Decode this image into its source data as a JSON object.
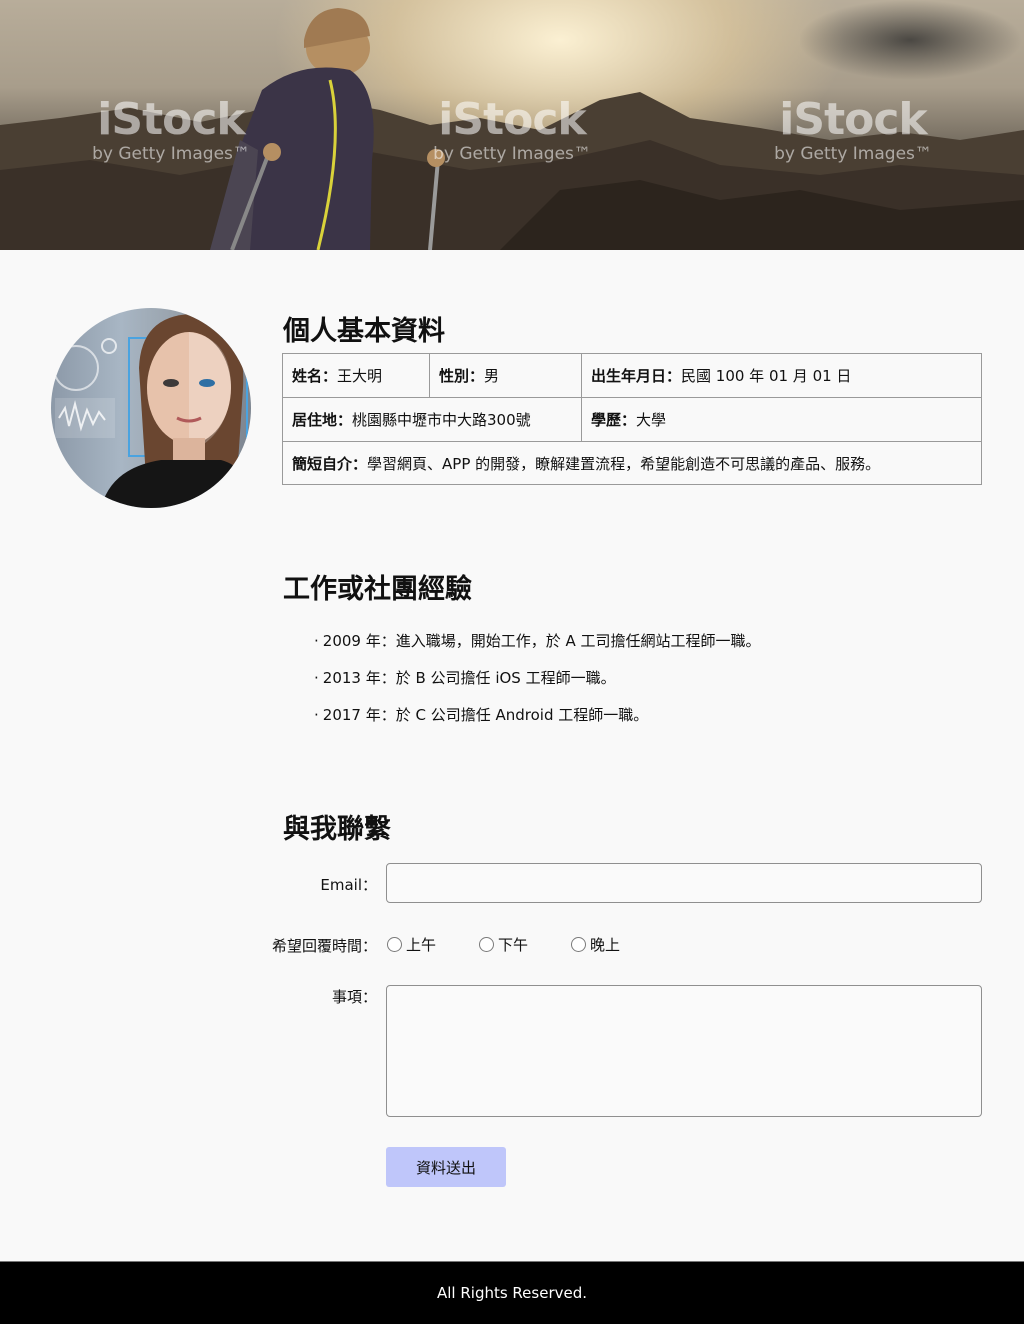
{
  "banner": {
    "watermarks": [
      {
        "main": "iStock",
        "sub": "by Getty Images™"
      },
      {
        "main": "iStock",
        "sub": "by Getty Images™"
      },
      {
        "main": "iStock",
        "sub": "by Getty Images™"
      }
    ]
  },
  "basic_info": {
    "title": "個人基本資料",
    "name": {
      "key": "姓名：",
      "value": "王大明"
    },
    "gender": {
      "key": "性別：",
      "value": "男"
    },
    "birthday": {
      "key": "出生年月日：",
      "value": "民國 100 年 01 月 01 日"
    },
    "address": {
      "key": "居住地：",
      "value": "桃園縣中壢市中大路300號"
    },
    "education": {
      "key": "學歷：",
      "value": "大學"
    },
    "intro": {
      "key": "簡短自介：",
      "value": "學習網頁、APP 的開發，瞭解建置流程，希望能創造不可思議的產品、服務。"
    }
  },
  "experience": {
    "title": "工作或社團經驗",
    "items": [
      "2009 年：進入職場，開始工作，於 A 工司擔任網站工程師一職。",
      "2013 年：於 B 公司擔任 iOS 工程師一職。",
      "2017 年：於 C 公司擔任 Android 工程師一職。"
    ]
  },
  "contact": {
    "title": "與我聯繫",
    "email_label": "Email：",
    "email_value": "",
    "time_label": "希望回覆時間：",
    "time_options": [
      "上午",
      "下午",
      "晚上"
    ],
    "note_label": "事項：",
    "note_value": "",
    "submit_label": "資料送出"
  },
  "footer": {
    "text": "All Rights Reserved."
  },
  "colors": {
    "page_bg": "#f9f9f9",
    "submit_bg": "#bfc6fa",
    "footer_bg": "#000000"
  }
}
